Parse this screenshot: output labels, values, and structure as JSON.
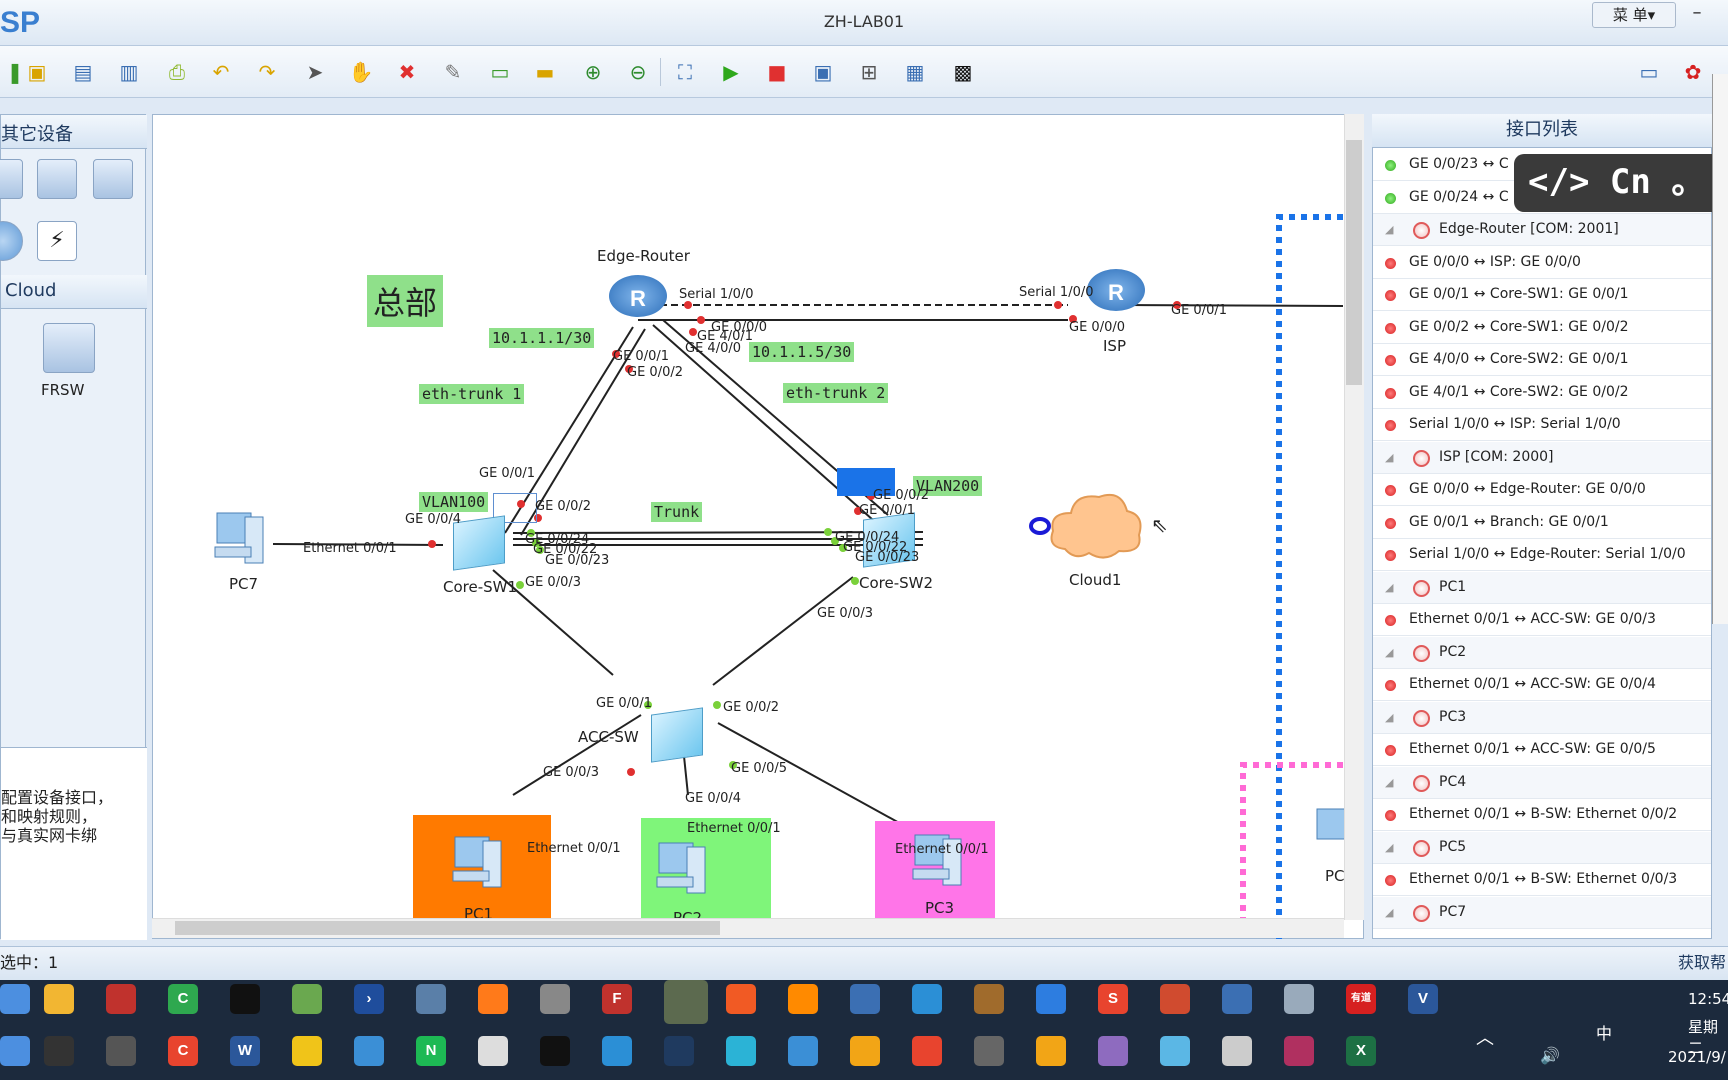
{
  "app": {
    "logo": "SP",
    "title": "ZH-LAB01",
    "menu_label": "菜 单▾",
    "minimize": "–"
  },
  "toolbar": {
    "icons": [
      "new-icon",
      "open-icon",
      "save-icon",
      "save-as-icon",
      "print-icon",
      "undo-icon",
      "redo-icon",
      "select-icon",
      "pan-icon",
      "delete-icon",
      "delete-all-icon",
      "textbox-icon",
      "palette-icon",
      "zoom-in-icon",
      "zoom-out-icon",
      "fit-icon",
      "start-icon",
      "stop-icon",
      "capture-icon",
      "topology-icon",
      "grid-icon",
      "screenshot-icon",
      "chat-icon",
      "huawei-icon"
    ]
  },
  "left_panel": {
    "section1_title": "其它设备",
    "section2_title": "Cloud",
    "frsw_label": "FRSW",
    "description": [
      "配置设备接口，",
      "和映射规则，",
      "与真实网卡绑"
    ]
  },
  "canvas": {
    "region_label": "总部",
    "devices": {
      "edge_router": "Edge-Router",
      "isp": "ISP",
      "core_sw1": "Core-SW1",
      "core_sw2": "Core-SW2",
      "acc_sw": "ACC-SW",
      "pc7": "PC7",
      "pc1": "PC1",
      "pc2": "PC2",
      "pc3": "PC3",
      "cloud1": "Cloud1",
      "pc_partial": "PC"
    },
    "tags": {
      "ip1": "10.1.1.1/30",
      "ip2": "10.1.1.5/30",
      "trunk1": "eth-trunk 1",
      "trunk2": "eth-trunk 2",
      "vlan100": "VLAN100",
      "vlan200": "VLAN200",
      "trunk": "Trunk"
    },
    "ports": {
      "er_s100": "Serial 1/0/0",
      "er_g000": "GE 0/0/0",
      "er_g401": "GE 4/0/1",
      "er_g400": "GE 4/0/0",
      "er_g001": "GE 0/0/1",
      "er_g002": "GE 0/0/2",
      "isp_s100": "Serial 1/0/0",
      "isp_g000": "GE 0/0/0",
      "isp_g001": "GE 0/0/1",
      "c1_g001": "GE 0/0/1",
      "c1_g002": "GE 0/0/2",
      "c1_g004": "GE 0/0/4",
      "c1_g024": "GE 0/0/24",
      "c1_g022": "GE 0/0/22",
      "c1_g023": "GE 0/0/23",
      "c1_g003": "GE 0/0/3",
      "pc7_eth": "Ethernet 0/0/1",
      "c2_g002": "GE 0/0/2",
      "c2_g001": "GE 0/0/1",
      "c2_g024": "GE 0/0/24",
      "c2_g022": "GE 0/0/22",
      "c2_g023": "GE 0/0/23",
      "c2_g003": "GE 0/0/3",
      "acc_g001": "GE 0/0/1",
      "acc_g002": "GE 0/0/2",
      "acc_g003": "GE 0/0/3",
      "acc_g004": "GE 0/0/4",
      "acc_g005": "GE 0/0/5",
      "pc1_eth": "Ethernet 0/0/1",
      "pc2_eth": "Ethernet 0/0/1",
      "pc3_eth": "Ethernet 0/0/1"
    }
  },
  "interface_panel": {
    "title": "接口列表",
    "rows": [
      {
        "type": "link",
        "status": "green",
        "text": "GE 0/0/23 ↔ C"
      },
      {
        "type": "link",
        "status": "green",
        "text": "GE 0/0/24 ↔ C"
      },
      {
        "type": "device",
        "text": "Edge-Router [COM: 2001]"
      },
      {
        "type": "link",
        "status": "red",
        "text": "GE 0/0/0 ↔ ISP: GE 0/0/0"
      },
      {
        "type": "link",
        "status": "red",
        "text": "GE 0/0/1 ↔ Core-SW1: GE 0/0/1"
      },
      {
        "type": "link",
        "status": "red",
        "text": "GE 0/0/2 ↔ Core-SW1: GE 0/0/2"
      },
      {
        "type": "link",
        "status": "red",
        "text": "GE 4/0/0 ↔ Core-SW2: GE 0/0/1"
      },
      {
        "type": "link",
        "status": "red",
        "text": "GE 4/0/1 ↔ Core-SW2: GE 0/0/2"
      },
      {
        "type": "link",
        "status": "red",
        "text": "Serial 1/0/0 ↔ ISP: Serial 1/0/0"
      },
      {
        "type": "device",
        "text": "ISP [COM: 2000]"
      },
      {
        "type": "link",
        "status": "red",
        "text": "GE 0/0/0 ↔ Edge-Router: GE 0/0/0"
      },
      {
        "type": "link",
        "status": "red",
        "text": "GE 0/0/1 ↔ Branch: GE 0/0/1"
      },
      {
        "type": "link",
        "status": "red",
        "text": "Serial 1/0/0 ↔ Edge-Router: Serial 1/0/0"
      },
      {
        "type": "device",
        "text": "PC1"
      },
      {
        "type": "link",
        "status": "red",
        "text": "Ethernet 0/0/1 ↔ ACC-SW: GE 0/0/3"
      },
      {
        "type": "device",
        "text": "PC2"
      },
      {
        "type": "link",
        "status": "red",
        "text": "Ethernet 0/0/1 ↔ ACC-SW: GE 0/0/4"
      },
      {
        "type": "device",
        "text": "PC3"
      },
      {
        "type": "link",
        "status": "red",
        "text": "Ethernet 0/0/1 ↔ ACC-SW: GE 0/0/5"
      },
      {
        "type": "device",
        "text": "PC4"
      },
      {
        "type": "link",
        "status": "red",
        "text": "Ethernet 0/0/1 ↔ B-SW: Ethernet 0/0/2"
      },
      {
        "type": "device",
        "text": "PC5"
      },
      {
        "type": "link",
        "status": "red",
        "text": "Ethernet 0/0/1 ↔ B-SW: Ethernet 0/0/3"
      },
      {
        "type": "device",
        "text": "PC7"
      }
    ]
  },
  "overlay": {
    "code": "</>",
    "text": "Cn",
    "punct": "。"
  },
  "statusbar": {
    "selected": "选中：1",
    "help": "获取帮"
  },
  "tray": {
    "time": "12:54",
    "day": "星期二",
    "date": "2021/9/",
    "ime": "中"
  }
}
